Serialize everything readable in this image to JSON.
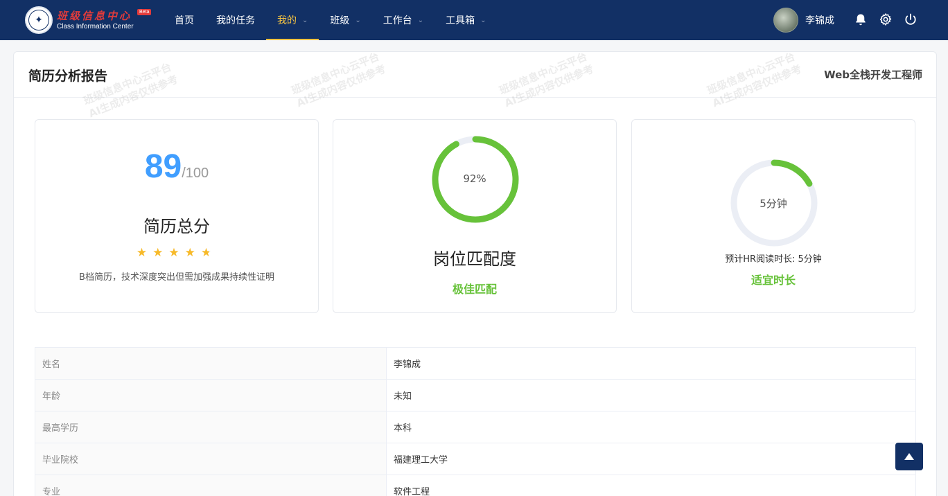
{
  "header": {
    "logo_cn": "班级信息中心",
    "logo_en": "Class Information Center",
    "logo_beta": "Beta",
    "nav": [
      {
        "label": "首页",
        "dropdown": false,
        "active": false
      },
      {
        "label": "我的任务",
        "dropdown": false,
        "active": false
      },
      {
        "label": "我的",
        "dropdown": true,
        "active": true
      },
      {
        "label": "班级",
        "dropdown": true,
        "active": false
      },
      {
        "label": "工作台",
        "dropdown": true,
        "active": false
      },
      {
        "label": "工具箱",
        "dropdown": true,
        "active": false
      }
    ],
    "user_name": "李锦成",
    "icons": [
      "bell-icon",
      "gear-icon",
      "power-icon"
    ]
  },
  "report": {
    "title": "简历分析报告",
    "position": "Web全栈开发工程师",
    "watermark_line1": "班级信息中心云平台",
    "watermark_line2": "AI生成内容仅供参考",
    "score": {
      "value": "89",
      "total": "/100",
      "label": "简历总分",
      "stars_rating": 4.5,
      "stars_max": 5,
      "desc": "B档简历，技术深度突出但需加强成果持续性证明"
    },
    "match": {
      "percent": 92,
      "percent_text": "92%",
      "label": "岗位匹配度",
      "tag": "极佳匹配"
    },
    "reading": {
      "fraction": 0.17,
      "ring_text": "5分钟",
      "note": "预计HR阅读时长: 5分钟",
      "tag": "适宜时长"
    }
  },
  "info_rows": [
    {
      "key": "姓名",
      "value": "李锦成"
    },
    {
      "key": "年龄",
      "value": "未知"
    },
    {
      "key": "最高学历",
      "value": "本科"
    },
    {
      "key": "毕业院校",
      "value": "福建理工大学"
    },
    {
      "key": "专业",
      "value": "软件工程"
    }
  ],
  "colors": {
    "nav_bg": "#123065",
    "active": "#f5c443",
    "primary": "#409eff",
    "success": "#67c23a",
    "track": "#ebeef5"
  }
}
